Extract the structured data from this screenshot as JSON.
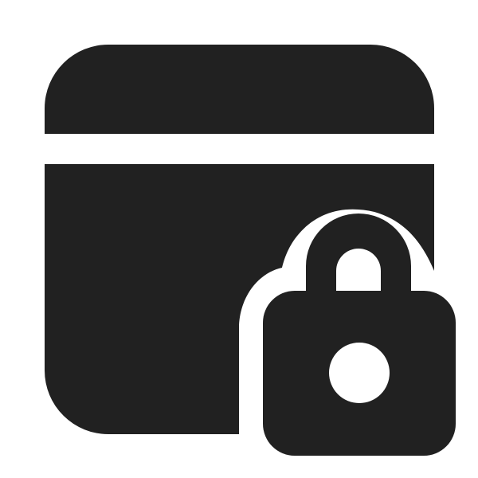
{
  "icon": {
    "name": "calendar-lock-icon",
    "fill_color": "#212121",
    "background_color": "#ffffff"
  }
}
